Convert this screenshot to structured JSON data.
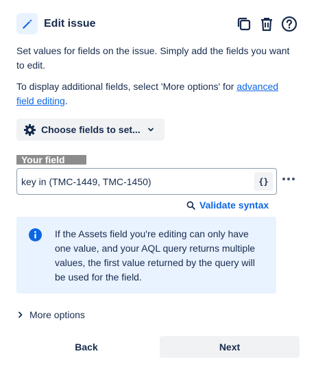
{
  "header": {
    "title": "Edit issue",
    "icon": "pencil-icon",
    "actions": [
      "copy-icon",
      "trash-icon",
      "help-icon"
    ]
  },
  "description": {
    "line1": "Set values for fields on the issue. Simply add the fields you want to edit.",
    "line2_prefix": "To display additional fields, select 'More options' for ",
    "line2_link": "advanced field editing",
    "line2_suffix": "."
  },
  "choose_fields": {
    "label": "Choose fields to set...",
    "icon": "gear-icon"
  },
  "field": {
    "label": "Your field",
    "value": "key in (TMC-1449, TMC-1450)",
    "json_button": "{}"
  },
  "validate": {
    "label": "Validate syntax",
    "icon": "search-icon"
  },
  "info": {
    "text": "If the Assets field you're editing can only have one value, and your AQL query returns multiple values, the first value returned by the query will be used for the field.",
    "icon": "info-icon",
    "accent_color": "#0c66e4"
  },
  "more_options": {
    "label": "More options"
  },
  "footer": {
    "back_label": "Back",
    "next_label": "Next"
  }
}
